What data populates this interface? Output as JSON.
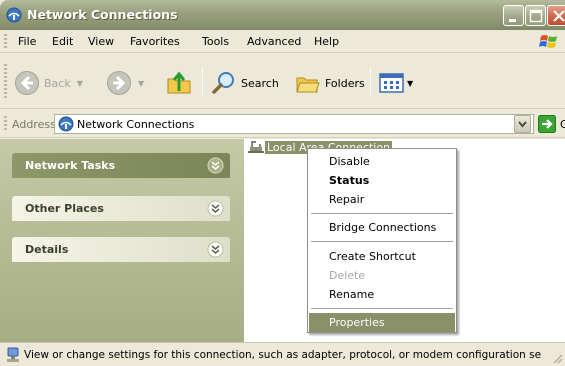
{
  "window": {
    "title": "Network Connections",
    "icons": {
      "app": "network-connections-icon",
      "minimize": "minimize-icon",
      "maximize": "maximize-icon",
      "close": "close-icon"
    }
  },
  "menubar": {
    "items": [
      "File",
      "Edit",
      "View",
      "Favorites",
      "Tools",
      "Advanced",
      "Help"
    ]
  },
  "toolbar": {
    "back": "Back",
    "search": "Search",
    "folders": "Folders",
    "icons": [
      "back-arrow-icon",
      "forward-arrow-icon",
      "up-folder-icon",
      "search-icon",
      "folders-icon",
      "views-icon"
    ]
  },
  "address": {
    "label": "Address",
    "value": "Network Connections",
    "go": "Go"
  },
  "taskpane": {
    "panels": [
      {
        "label": "Network Tasks",
        "expanded": false
      },
      {
        "label": "Other Places",
        "expanded": false
      },
      {
        "label": "Details",
        "expanded": false
      }
    ]
  },
  "content": {
    "items": [
      {
        "label": "Local Area Connection",
        "selected": true
      }
    ]
  },
  "context_menu": {
    "items": [
      {
        "label": "Disable"
      },
      {
        "label": "Status",
        "bold": true
      },
      {
        "label": "Repair"
      },
      {
        "label": "Bridge Connections"
      },
      {
        "label": "Create Shortcut"
      },
      {
        "label": "Delete",
        "disabled": true
      },
      {
        "label": "Rename"
      },
      {
        "label": "Properties",
        "highlighted": true
      }
    ]
  },
  "statusbar": {
    "text": "View or change settings for this connection, such as adapter, protocol, or modem configuration se"
  },
  "colors": {
    "theme_olive": "#8a9068",
    "title_start": "#b3bb9b",
    "close_button": "#d2664a",
    "taskpane_bg": "#b2b891"
  }
}
